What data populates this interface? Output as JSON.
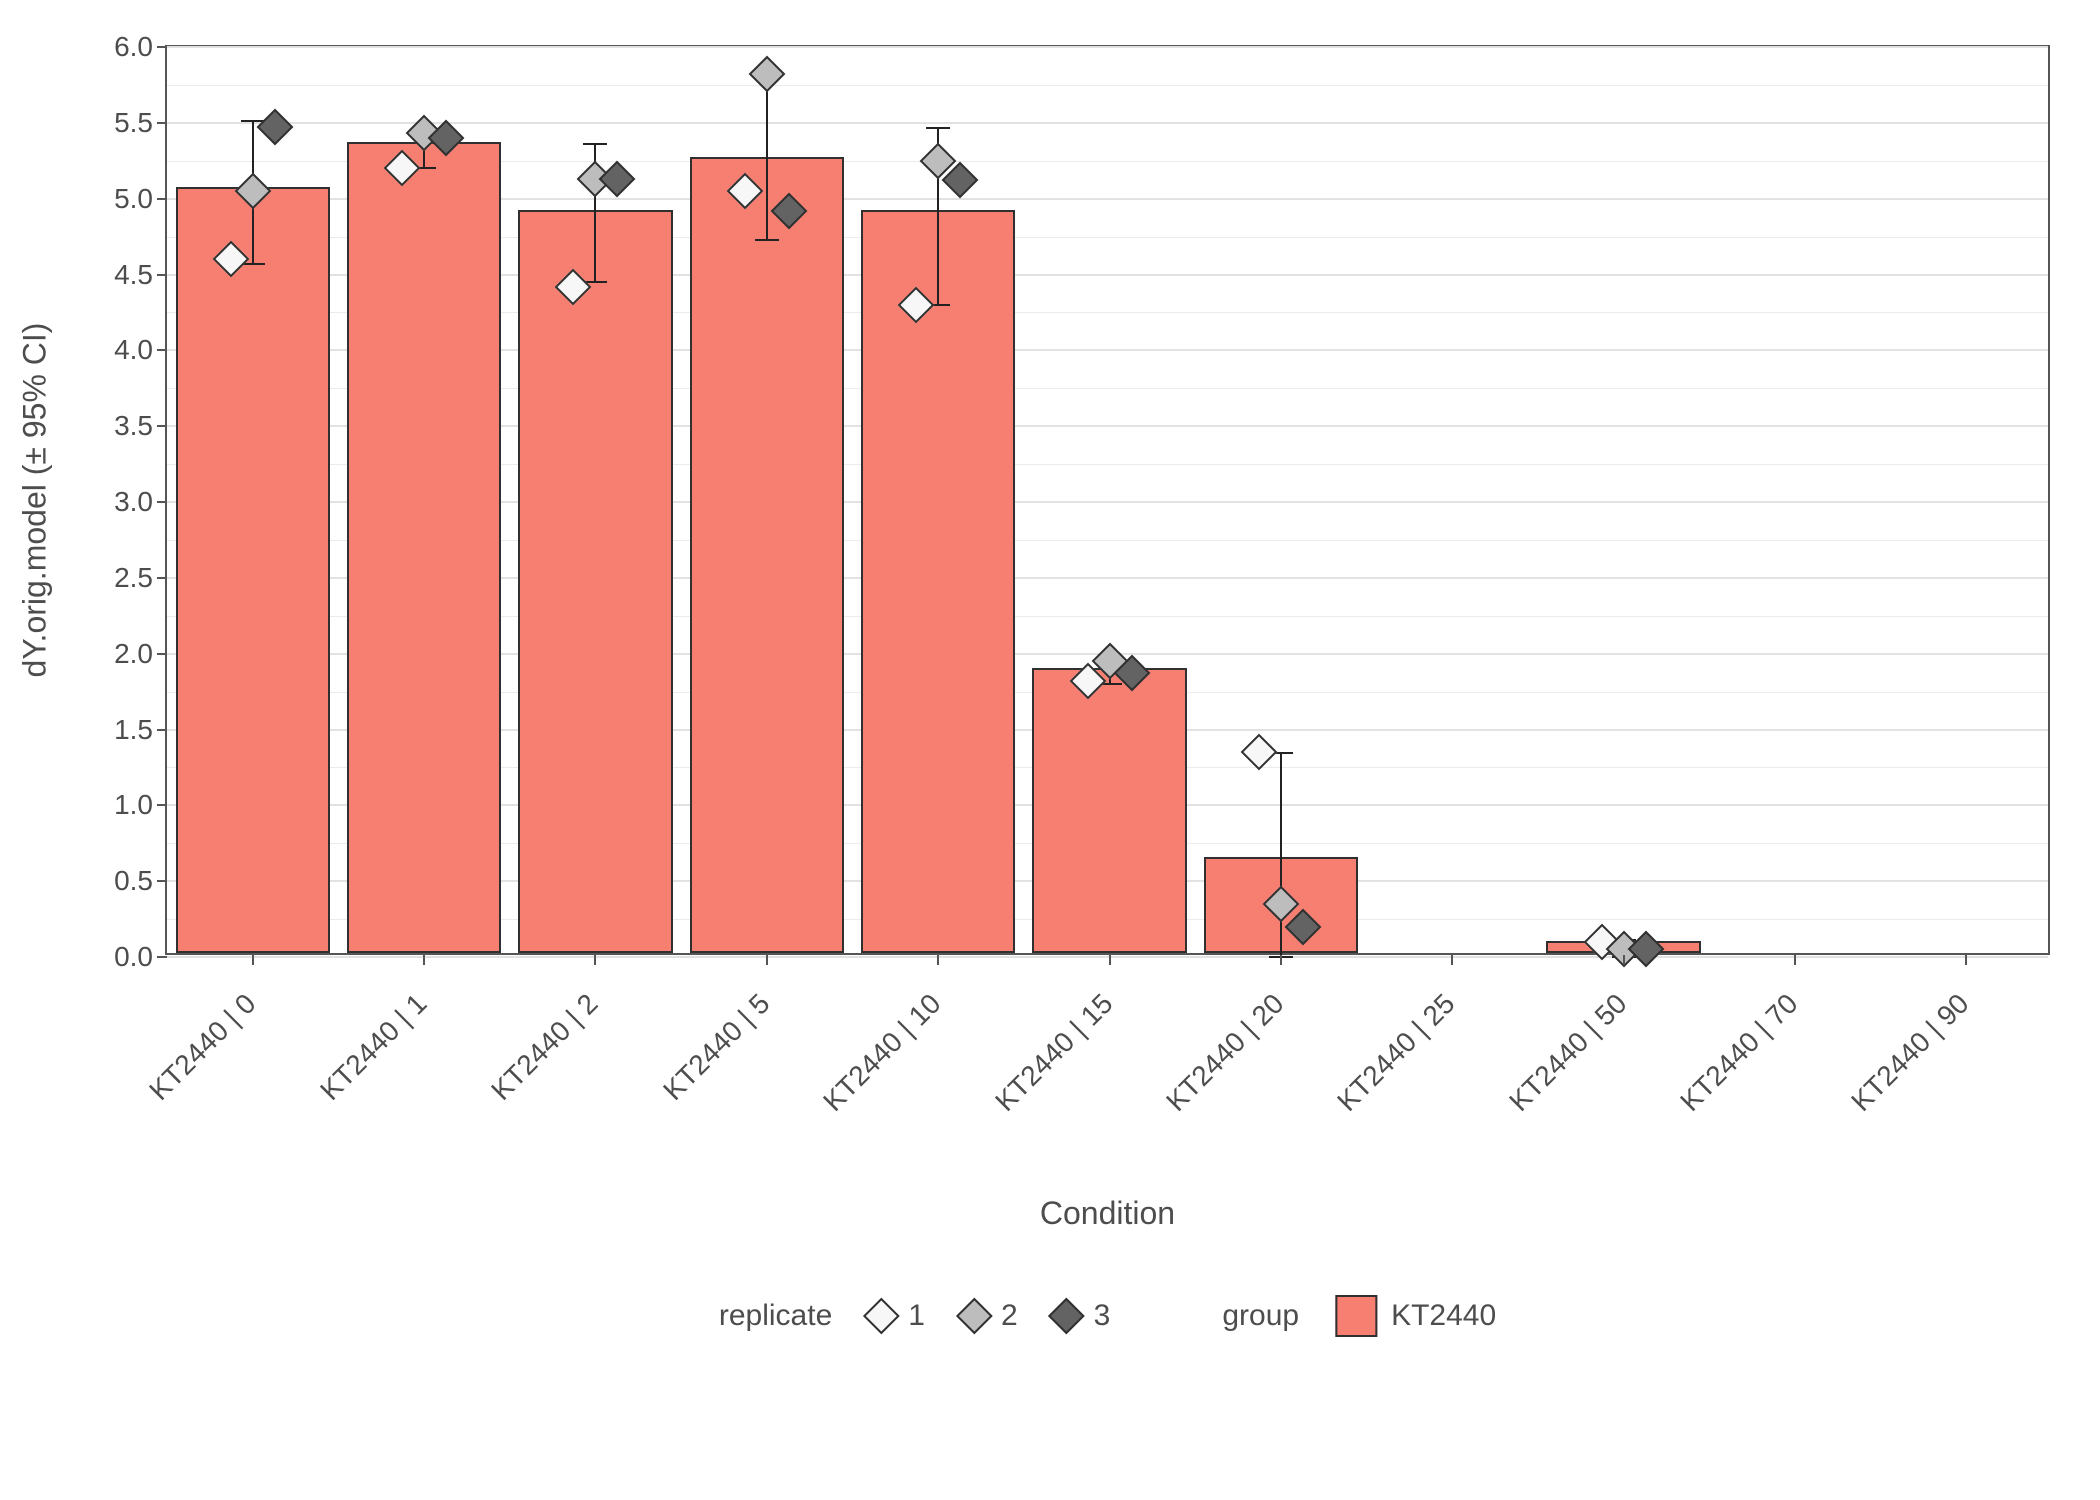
{
  "chart_data": {
    "type": "bar",
    "title": "",
    "xlabel": "Condition",
    "ylabel": "dY.orig.model (± 95% CI)",
    "ylim": [
      0.0,
      6.0
    ],
    "ytick_step": 0.5,
    "categories": [
      "KT2440 | 0",
      "KT2440 | 1",
      "KT2440 | 2",
      "KT2440 | 5",
      "KT2440 | 10",
      "KT2440 | 15",
      "KT2440 | 20",
      "KT2440 | 25",
      "KT2440 | 50",
      "KT2440 | 70",
      "KT2440 | 90"
    ],
    "values": [
      5.05,
      5.35,
      4.9,
      5.25,
      4.9,
      1.88,
      0.63,
      0.0,
      0.08,
      0.0,
      0.0
    ],
    "ci_low": [
      4.57,
      5.2,
      4.45,
      4.73,
      4.3,
      1.8,
      -0.1,
      0.0,
      0.0,
      0.0,
      0.0
    ],
    "ci_high": [
      5.52,
      5.47,
      5.37,
      5.8,
      5.47,
      1.97,
      1.35,
      0.0,
      0.12,
      0.0,
      0.0
    ],
    "series": [
      {
        "name": "1",
        "fill": "#f7f7f7",
        "values": [
          4.6,
          5.2,
          4.42,
          5.05,
          4.3,
          1.82,
          1.35,
          0.0,
          0.1,
          0.0,
          0.0
        ]
      },
      {
        "name": "2",
        "fill": "#bdbdbd",
        "values": [
          5.05,
          5.43,
          5.13,
          5.82,
          5.25,
          1.95,
          0.35,
          0.0,
          0.05,
          0.0,
          0.0
        ]
      },
      {
        "name": "3",
        "fill": "#636363",
        "values": [
          5.47,
          5.4,
          5.13,
          4.92,
          5.12,
          1.87,
          0.2,
          0.0,
          0.05,
          0.0,
          0.0
        ]
      }
    ],
    "bar_fill": "#f67f72",
    "group_name": "KT2440",
    "legend_title_points": "replicate",
    "legend_title_fill": "group"
  }
}
